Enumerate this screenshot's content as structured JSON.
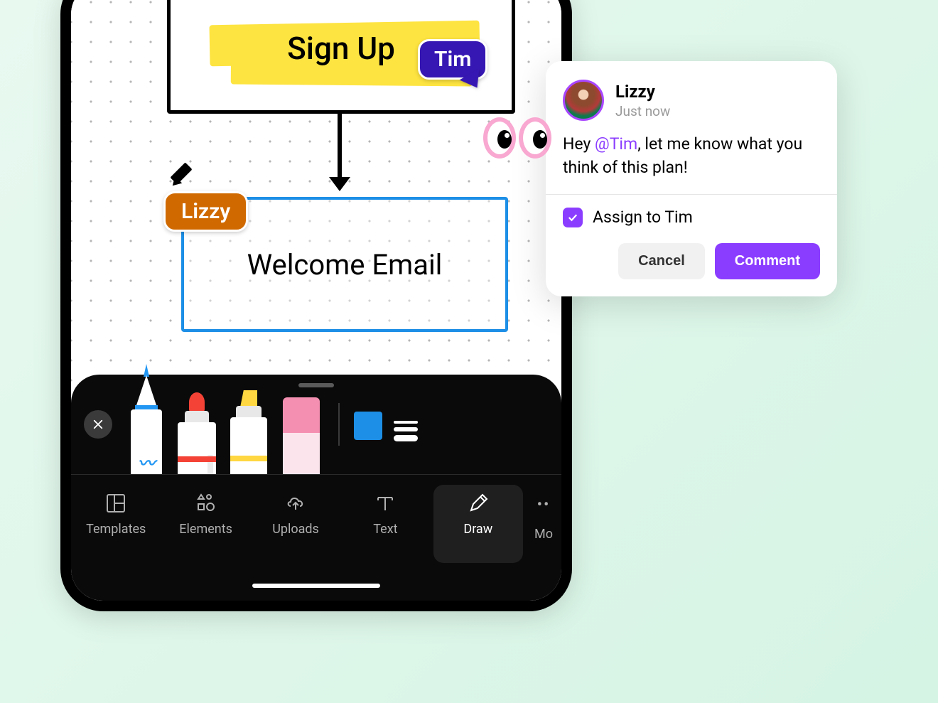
{
  "canvas": {
    "signup_label": "Sign Up",
    "welcome_label": "Welcome Email"
  },
  "cursors": {
    "tim": "Tim",
    "lizzy": "Lizzy"
  },
  "draw_toolbar": {
    "tools": [
      "pen",
      "marker",
      "highlighter",
      "eraser"
    ],
    "selected_color": "#1d8fe6"
  },
  "nav": {
    "items": [
      {
        "id": "templates",
        "label": "Templates"
      },
      {
        "id": "elements",
        "label": "Elements"
      },
      {
        "id": "uploads",
        "label": "Uploads"
      },
      {
        "id": "text",
        "label": "Text"
      },
      {
        "id": "draw",
        "label": "Draw"
      }
    ],
    "more_label": "Mo",
    "active": "draw"
  },
  "comment": {
    "author": "Lizzy",
    "time": "Just now",
    "body_prefix": "Hey ",
    "mention": "@Tim",
    "body_suffix": ", let me know what you think of this plan!",
    "assign_label": "Assign to Tim",
    "assign_checked": true,
    "cancel_label": "Cancel",
    "submit_label": "Comment"
  }
}
